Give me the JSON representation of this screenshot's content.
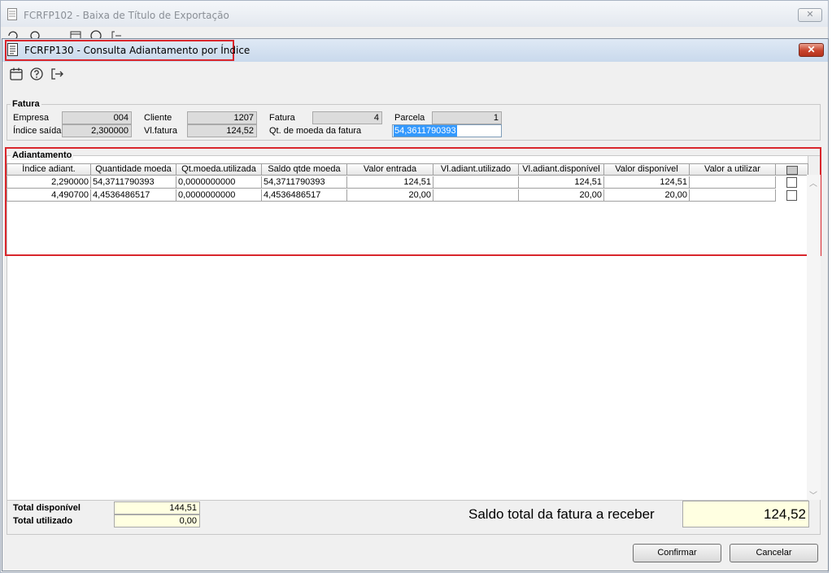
{
  "background_window": {
    "title": "FCRFP102 - Baixa de Título de Exportação",
    "close_glyph": "✕"
  },
  "dialog": {
    "title": "FCRFP130 - Consulta Adiantamento por Índice",
    "close_glyph": "✕",
    "toolbar": [
      "calendar-icon",
      "help-icon",
      "exit-icon"
    ]
  },
  "fatura": {
    "group_label": "Fatura",
    "empresa_label": "Empresa",
    "empresa_value": "004",
    "indice_saida_label": "Índice saída",
    "indice_saida_value": "2,300000",
    "cliente_label": "Cliente",
    "cliente_value": "1207",
    "vl_fatura_label": "Vl.fatura",
    "vl_fatura_value": "124,52",
    "fatura_label": "Fatura",
    "fatura_value": "4",
    "qt_moeda_label": "Qt. de moeda da fatura",
    "qt_moeda_value": "54,3611790393",
    "parcela_label": "Parcela",
    "parcela_value": "1"
  },
  "adiantamento": {
    "group_label": "Adiantamento",
    "columns": [
      "Índice adiant.",
      "Quantidade moeda",
      "Qt.moeda.utilizada",
      "Saldo qtde moeda",
      "Valor entrada",
      "Vl.adiant.utilizado",
      "Vl.adiant.disponível",
      "Valor disponível",
      "Valor a utilizar"
    ],
    "rows": [
      [
        "2,290000",
        "54,3711790393",
        "0,0000000000",
        "54,3711790393",
        "124,51",
        "",
        "124,51",
        "124,51",
        ""
      ],
      [
        "4,490700",
        "4,4536486517",
        "0,0000000000",
        "4,4536486517",
        "20,00",
        "",
        "20,00",
        "20,00",
        ""
      ]
    ]
  },
  "totals": {
    "disponivel_label": "Total disponível",
    "disponivel_value": "144,51",
    "utilizado_label": "Total utilizado",
    "utilizado_value": "0,00",
    "saldo_label": "Saldo total da fatura a receber",
    "saldo_value": "124,52"
  },
  "buttons": {
    "confirmar": "Confirmar",
    "cancelar": "Cancelar"
  },
  "colors": {
    "highlight": "#d9262c",
    "selection": "#3399ff",
    "total_bg": "#ffffe1"
  }
}
